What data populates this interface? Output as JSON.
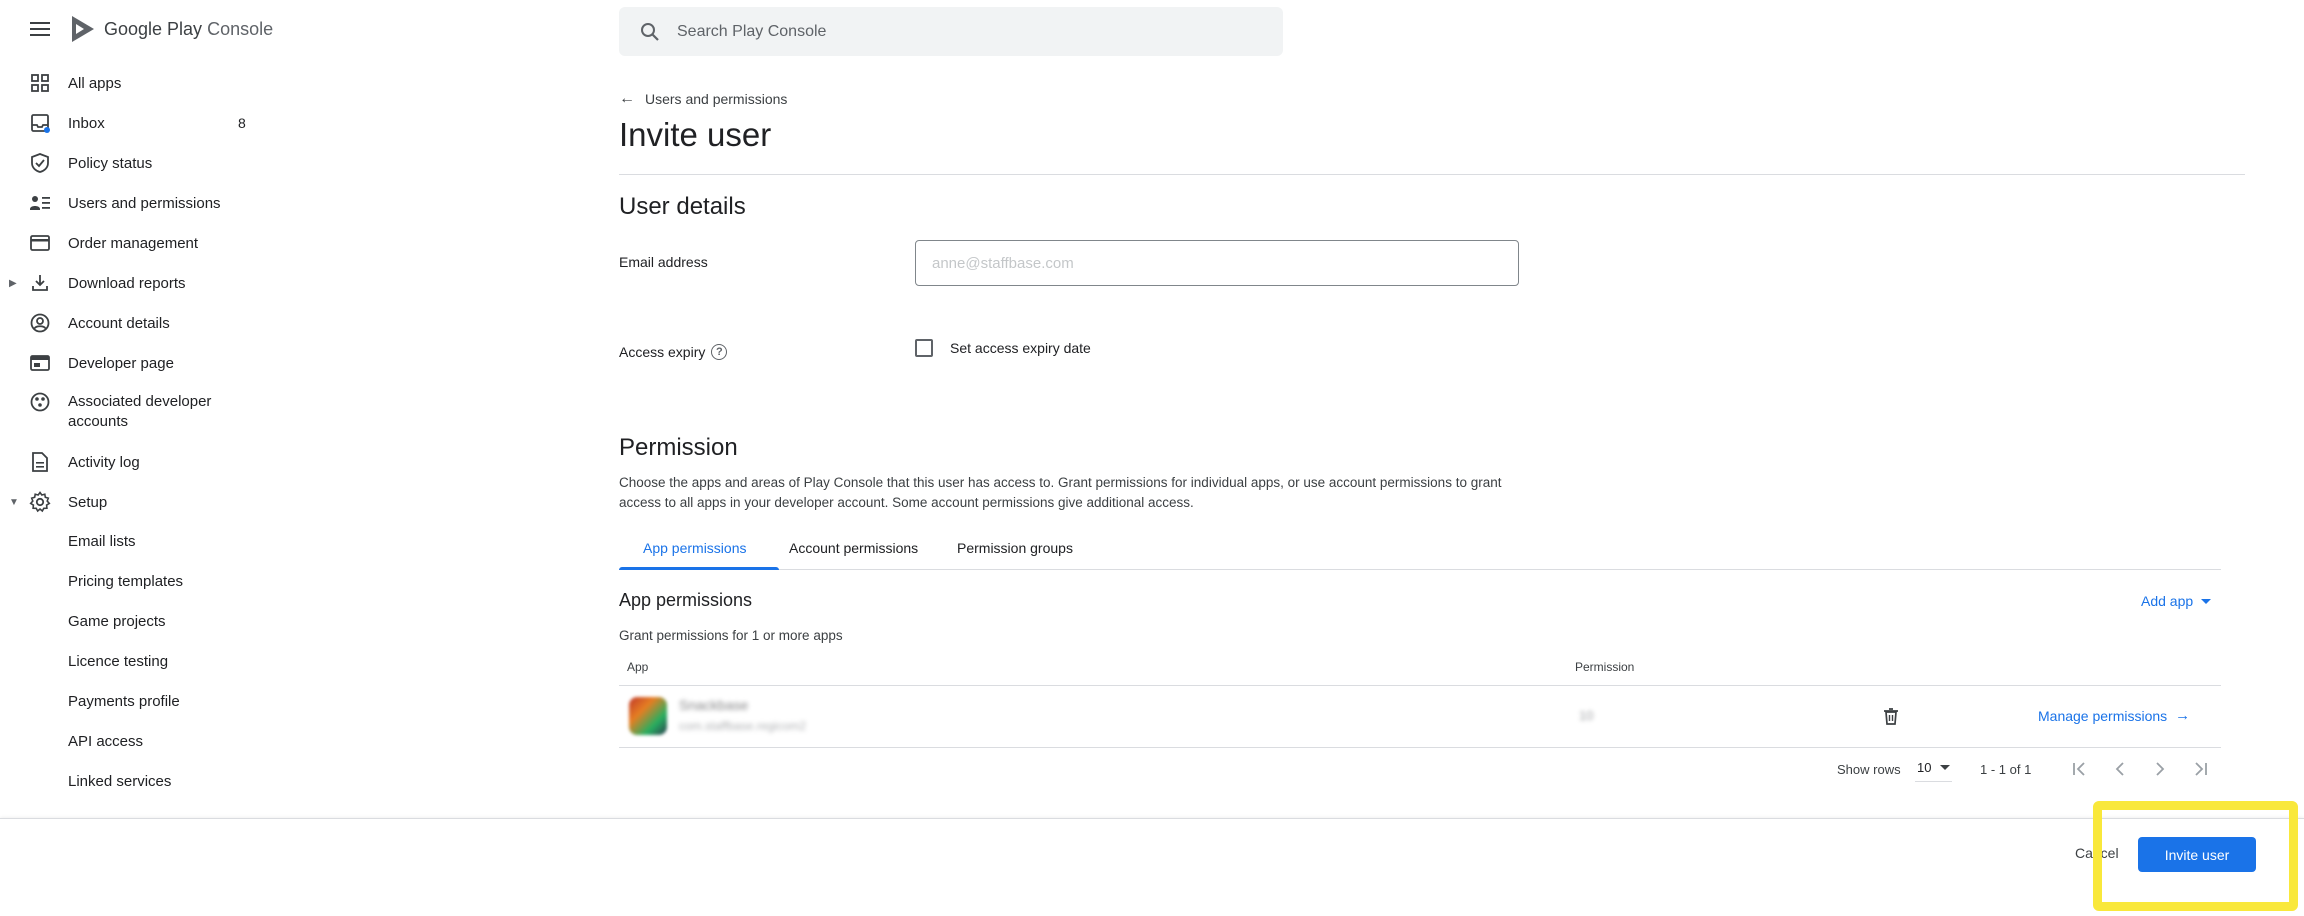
{
  "app": {
    "logo_text_google": "Google Play",
    "logo_text_console": "Console"
  },
  "search": {
    "placeholder": "Search Play Console"
  },
  "sidebar": {
    "items": [
      {
        "label": "All apps",
        "icon": "grid-icon"
      },
      {
        "label": "Inbox",
        "icon": "inbox-icon",
        "count": "8"
      },
      {
        "label": "Policy status",
        "icon": "shield-icon"
      },
      {
        "label": "Users and permissions",
        "icon": "users-icon"
      },
      {
        "label": "Order management",
        "icon": "card-icon"
      },
      {
        "label": "Download reports",
        "icon": "download-icon"
      },
      {
        "label": "Account details",
        "icon": "account-icon"
      },
      {
        "label": "Developer page",
        "icon": "web-page-icon"
      },
      {
        "label": "Associated developer accounts",
        "icon": "link-accounts-icon"
      },
      {
        "label": "Activity log",
        "icon": "document-icon"
      },
      {
        "label": "Setup",
        "icon": "gear-icon"
      }
    ],
    "setup_items": [
      "Email lists",
      "Pricing templates",
      "Game projects",
      "Licence testing",
      "Payments profile",
      "API access",
      "Linked services"
    ]
  },
  "main": {
    "back_label": "Users and permissions",
    "title": "Invite user",
    "user_details": {
      "heading": "User details",
      "email_label": "Email address",
      "email_placeholder": "anne@staffbase.com",
      "expiry_label": "Access expiry",
      "expiry_checkbox_label": "Set access expiry date"
    },
    "permission": {
      "heading": "Permission",
      "description": "Choose the apps and areas of Play Console that this user has access to. Grant permissions for individual apps, or use account permissions to grant access to all apps in your developer account. Some account permissions give additional access.",
      "tabs": [
        "App permissions",
        "Account permissions",
        "Permission groups"
      ],
      "app_permissions": {
        "heading": "App permissions",
        "add_app_label": "Add app",
        "description": "Grant permissions for 1 or more apps",
        "columns": {
          "app": "App",
          "permission": "Permission"
        },
        "rows": [
          {
            "app_name": "Snackbase",
            "package": "com.staffbase.regicom2",
            "permission_count": "10",
            "manage_label": "Manage permissions"
          }
        ],
        "pagination": {
          "show_rows_label": "Show rows",
          "rows_value": "10",
          "range": "1 - 1 of 1"
        }
      }
    }
  },
  "footer": {
    "cancel_label": "Cancel",
    "invite_label": "Invite user"
  },
  "colors": {
    "accent": "#1a73e8",
    "highlight": "#f9e83b"
  }
}
